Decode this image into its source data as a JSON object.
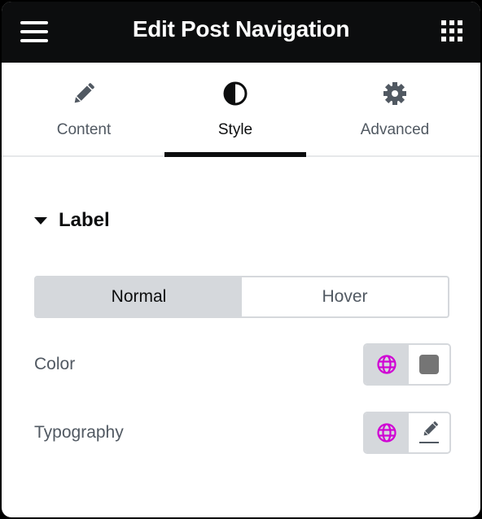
{
  "header": {
    "title": "Edit Post Navigation",
    "menu_icon": "hamburger-icon",
    "apps_icon": "grid-icon"
  },
  "tabs": [
    {
      "label": "Content",
      "icon": "pencil-icon",
      "active": false
    },
    {
      "label": "Style",
      "icon": "half-circle-icon",
      "active": true
    },
    {
      "label": "Advanced",
      "icon": "gear-icon",
      "active": false
    }
  ],
  "section": {
    "title": "Label",
    "expanded": true
  },
  "state_toggle": {
    "options": [
      "Normal",
      "Hover"
    ],
    "selected": "Normal"
  },
  "controls": [
    {
      "label": "Color",
      "global_icon": "globe-icon",
      "value_icon": "color-swatch",
      "swatch_color": "#757575"
    },
    {
      "label": "Typography",
      "global_icon": "globe-icon",
      "value_icon": "pencil-edit-icon"
    }
  ],
  "colors": {
    "header_bg": "#0c0d0e",
    "global_accent": "#d004d4",
    "muted_text": "#515962",
    "control_bg": "#d5d8dc"
  }
}
